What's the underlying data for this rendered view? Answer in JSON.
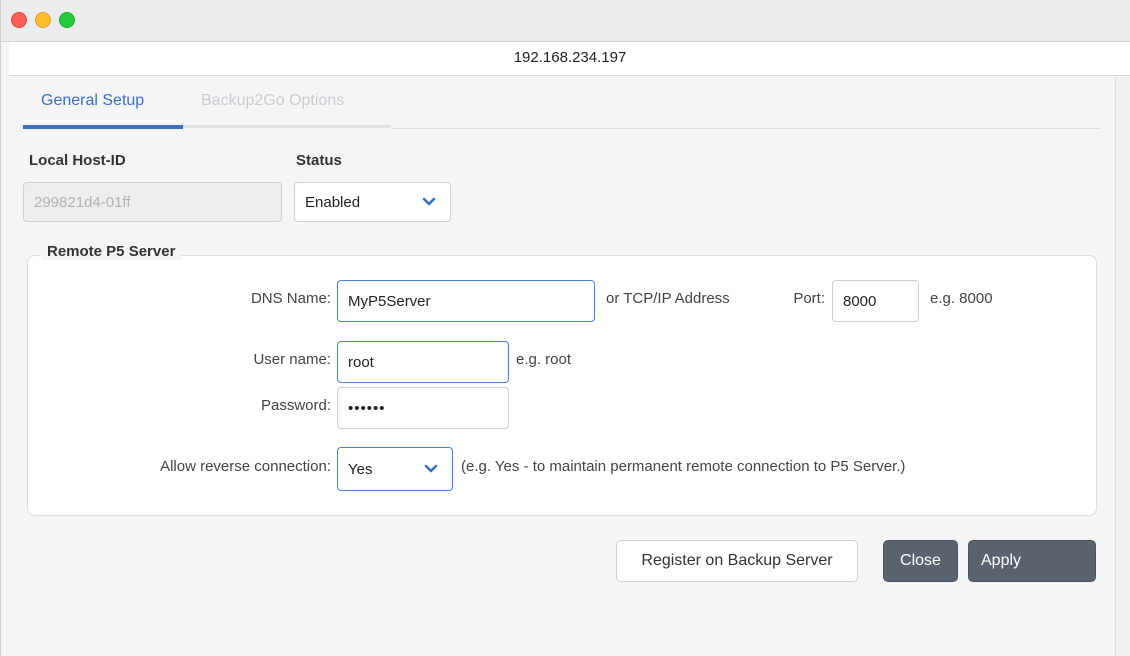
{
  "window": {
    "url": "192.168.234.197"
  },
  "tabs": [
    {
      "label": "General Setup",
      "active": true
    },
    {
      "label": "Backup2Go Options",
      "active": false
    }
  ],
  "general": {
    "host_id_label": "Local Host-ID",
    "host_id_value": "299821d4-01ff",
    "status_label": "Status",
    "status_value": "Enabled"
  },
  "remote": {
    "legend": "Remote P5 Server",
    "dns_label": "DNS Name:",
    "dns_value": "MyP5Server",
    "dns_hint": "or TCP/IP Address",
    "port_label": "Port:",
    "port_value": "8000",
    "port_hint": "e.g. 8000",
    "user_label": "User name:",
    "user_value": "root",
    "user_hint": "e.g. root",
    "password_label": "Password:",
    "password_value": "••••••",
    "reverse_label": "Allow reverse connection:",
    "reverse_value": "Yes",
    "reverse_hint": "(e.g. Yes - to maintain permanent remote connection to P5 Server.)"
  },
  "buttons": {
    "register": "Register on Backup Server",
    "close": "Close",
    "apply": "Apply"
  },
  "colors": {
    "accent": "#3a6fc4",
    "dark_button": "#5a6270"
  }
}
